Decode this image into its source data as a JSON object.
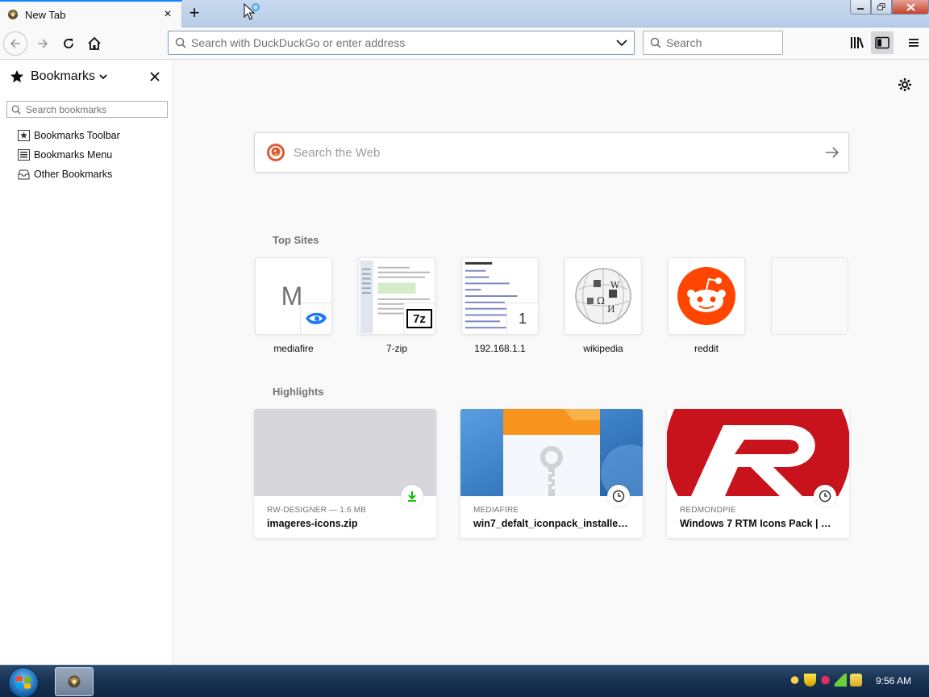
{
  "tab": {
    "title": "New Tab",
    "close_icon": "×",
    "new_tab_icon": "+"
  },
  "nav": {
    "url_placeholder": "Search with DuckDuckGo or enter address",
    "search_placeholder": "Search"
  },
  "sidebar": {
    "title": "Bookmarks",
    "search_placeholder": "Search bookmarks",
    "items": [
      {
        "label": "Bookmarks Toolbar",
        "icon": "bookmarks-toolbar-icon"
      },
      {
        "label": "Bookmarks Menu",
        "icon": "bookmarks-menu-icon"
      },
      {
        "label": "Other Bookmarks",
        "icon": "other-bookmarks-icon"
      }
    ]
  },
  "main": {
    "web_search_placeholder": "Search the Web",
    "top_sites_title": "Top Sites",
    "top_sites": [
      {
        "label": "mediafire",
        "letter": "M"
      },
      {
        "label": "7-zip",
        "badge": "7z"
      },
      {
        "label": "192.168.1.1",
        "badge": "1"
      },
      {
        "label": "wikipedia"
      },
      {
        "label": "reddit"
      },
      {
        "label": ""
      }
    ],
    "highlights_title": "Highlights",
    "highlights": [
      {
        "source": "RW-DESIGNER — 1.6 MB",
        "title": "imageres-icons.zip",
        "icon": "download-icon"
      },
      {
        "source": "MEDIAFIRE",
        "title": "win7_defalt_iconpack_installer…",
        "icon": "clock-icon"
      },
      {
        "source": "REDMONDPIE",
        "title": "Windows 7 RTM Icons Pack | R…",
        "icon": "clock-icon"
      }
    ]
  },
  "taskbar": {
    "clock": "9:56 AM"
  },
  "colors": {
    "accent": "#0a84ff",
    "reddit": "#ff4500",
    "redmondpie": "#c8121c",
    "download": "#12bc00"
  }
}
